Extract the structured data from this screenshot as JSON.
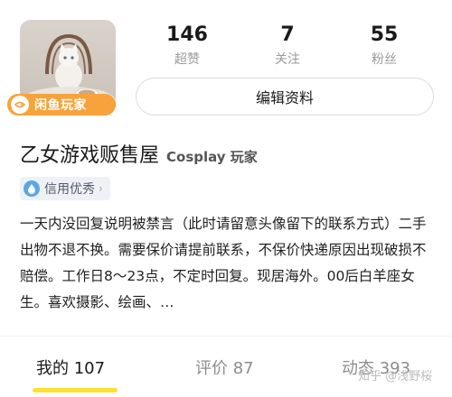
{
  "profile": {
    "name": "乙女游戏贩售屋",
    "tag": "Cosplay 玩家",
    "badge_label": "闲鱼玩家",
    "credit_label": "信用优秀",
    "credit_arrow": "›"
  },
  "stats": [
    {
      "value": "146",
      "label": "超赞"
    },
    {
      "value": "7",
      "label": "关注"
    },
    {
      "value": "55",
      "label": "粉丝"
    }
  ],
  "edit_button": "编辑资料",
  "bio": "一天内没回复说明被禁言（此时请留意头像留下的联系方式）二手出物不退不换。需要保价请提前联系，不保价快递原因出现破损不赔偿。工作日8～23点，不定时回复。现居海外。00后白羊座女生。喜欢摄影、绘画、…",
  "tabs": [
    {
      "label": "我的 107"
    },
    {
      "label": "评价 87"
    },
    {
      "label": "动态 393"
    }
  ],
  "watermark": "知乎 @浅野桜",
  "colors": {
    "badge": "#f7a23a",
    "tab_underline": "#ffe033",
    "credit_icon": "#5aa6e8"
  }
}
